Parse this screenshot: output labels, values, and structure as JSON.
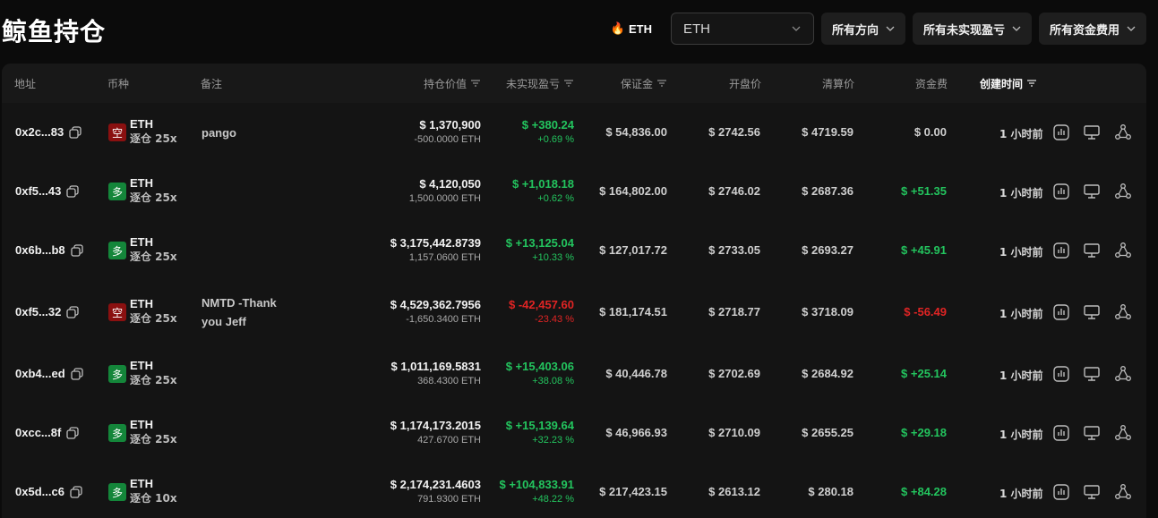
{
  "page_title": "鲸鱼持仓",
  "hot_token": {
    "icon": "fire-icon",
    "label": "ETH"
  },
  "token_select": {
    "value": "ETH"
  },
  "filters": {
    "direction": "所有方向",
    "unrealized_pnl": "所有未实现盈亏",
    "funding_fee": "所有资金费用"
  },
  "columns": {
    "address": "地址",
    "coin": "币种",
    "note": "备注",
    "position_value": "持仓价值",
    "unrealized_pnl": "未实现盈亏",
    "margin": "保证金",
    "entry_price": "开盘价",
    "liq_price": "清算价",
    "funding": "资金费",
    "created": "创建时间"
  },
  "colors": {
    "long": "#14863a",
    "short": "#8a1010",
    "positive": "#23c45e",
    "negative": "#e02424"
  },
  "rows": [
    {
      "address": "0x2c...83",
      "side": "空",
      "side_type": "short",
      "coin": "ETH",
      "leverage": "逐仓 25x",
      "note": "pango",
      "value": "$ 1,370,900",
      "size": "-500.0000 ETH",
      "pnl": "$ +380.24",
      "pnl_pct": "+0.69 %",
      "pnl_sign": "pos",
      "margin": "$ 54,836.00",
      "entry": "$ 2742.56",
      "liq": "$ 4719.59",
      "funding": "$ 0.00",
      "funding_sign": "zero",
      "time": "1 小时前"
    },
    {
      "address": "0xf5...43",
      "side": "多",
      "side_type": "long",
      "coin": "ETH",
      "leverage": "逐仓 25x",
      "note": "",
      "value": "$ 4,120,050",
      "size": "1,500.0000 ETH",
      "pnl": "$ +1,018.18",
      "pnl_pct": "+0.62 %",
      "pnl_sign": "pos",
      "margin": "$ 164,802.00",
      "entry": "$ 2746.02",
      "liq": "$ 2687.36",
      "funding": "$ +51.35",
      "funding_sign": "pos",
      "time": "1 小时前"
    },
    {
      "address": "0x6b...b8",
      "side": "多",
      "side_type": "long",
      "coin": "ETH",
      "leverage": "逐仓 25x",
      "note": "",
      "value": "$ 3,175,442.8739",
      "size": "1,157.0600 ETH",
      "pnl": "$ +13,125.04",
      "pnl_pct": "+10.33 %",
      "pnl_sign": "pos",
      "margin": "$ 127,017.72",
      "entry": "$ 2733.05",
      "liq": "$ 2693.27",
      "funding": "$ +45.91",
      "funding_sign": "pos",
      "time": "1 小时前"
    },
    {
      "address": "0xf5...32",
      "side": "空",
      "side_type": "short",
      "coin": "ETH",
      "leverage": "逐仓 25x",
      "note": "NMTD -Thank you Jeff",
      "value": "$ 4,529,362.7956",
      "size": "-1,650.3400 ETH",
      "pnl": "$ -42,457.60",
      "pnl_pct": "-23.43 %",
      "pnl_sign": "neg",
      "margin": "$ 181,174.51",
      "entry": "$ 2718.77",
      "liq": "$ 3718.09",
      "funding": "$ -56.49",
      "funding_sign": "neg",
      "time": "1 小时前"
    },
    {
      "address": "0xb4...ed",
      "side": "多",
      "side_type": "long",
      "coin": "ETH",
      "leverage": "逐仓 25x",
      "note": "",
      "value": "$ 1,011,169.5831",
      "size": "368.4300 ETH",
      "pnl": "$ +15,403.06",
      "pnl_pct": "+38.08 %",
      "pnl_sign": "pos",
      "margin": "$ 40,446.78",
      "entry": "$ 2702.69",
      "liq": "$ 2684.92",
      "funding": "$ +25.14",
      "funding_sign": "pos",
      "time": "1 小时前"
    },
    {
      "address": "0xcc...8f",
      "side": "多",
      "side_type": "long",
      "coin": "ETH",
      "leverage": "逐仓 25x",
      "note": "",
      "value": "$ 1,174,173.2015",
      "size": "427.6700 ETH",
      "pnl": "$ +15,139.64",
      "pnl_pct": "+32.23 %",
      "pnl_sign": "pos",
      "margin": "$ 46,966.93",
      "entry": "$ 2710.09",
      "liq": "$ 2655.25",
      "funding": "$ +29.18",
      "funding_sign": "pos",
      "time": "1 小时前"
    },
    {
      "address": "0x5d...c6",
      "side": "多",
      "side_type": "long",
      "coin": "ETH",
      "leverage": "逐仓 10x",
      "note": "",
      "value": "$ 2,174,231.4603",
      "size": "791.9300 ETH",
      "pnl": "$ +104,833.91",
      "pnl_pct": "+48.22 %",
      "pnl_sign": "pos",
      "margin": "$ 217,423.15",
      "entry": "$ 2613.12",
      "liq": "$ 280.18",
      "funding": "$ +84.28",
      "funding_sign": "pos",
      "time": "1 小时前"
    }
  ],
  "row_actions": [
    "chart-icon",
    "monitor-icon",
    "share-icon"
  ]
}
